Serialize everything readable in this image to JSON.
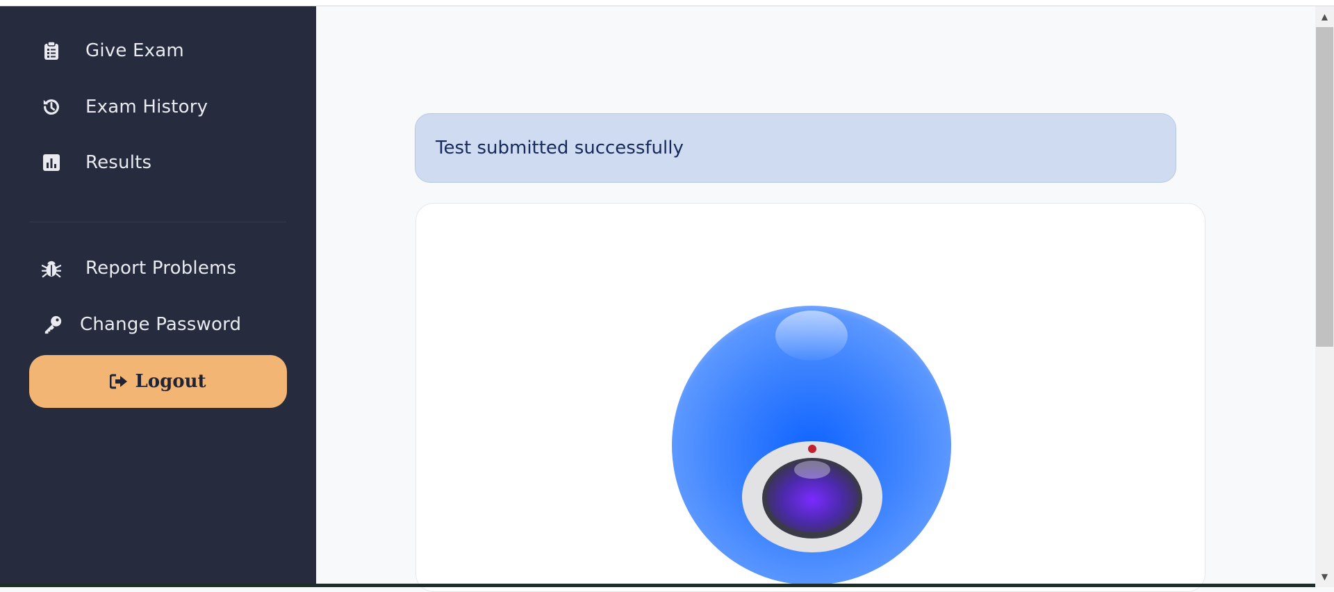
{
  "sidebar": {
    "items_top": [
      {
        "label": "Give Exam",
        "icon": "clipboard-list-icon"
      },
      {
        "label": "Exam History",
        "icon": "history-icon"
      },
      {
        "label": "Results",
        "icon": "chart-bar-icon"
      }
    ],
    "items_bottom": [
      {
        "label": "Report Problems",
        "icon": "bug-icon"
      },
      {
        "label": "Change Password",
        "icon": "key-icon"
      }
    ],
    "logout_label": "Logout"
  },
  "main": {
    "alert_text": "Test submitted successfully"
  },
  "colors": {
    "sidebar_bg": "#262b3e",
    "logout_bg": "#f3b574",
    "alert_bg": "#cfdbf0",
    "alert_text": "#152a5a",
    "page_bg": "#f8f9fa"
  }
}
